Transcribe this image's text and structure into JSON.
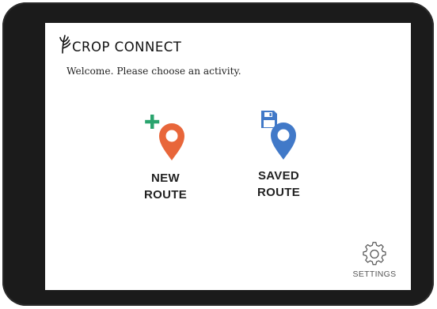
{
  "app": {
    "brand": "CROP CONNECT",
    "welcome_text": "Welcome. Please choose an activity."
  },
  "activities": [
    {
      "label_line1": "NEW",
      "label_line2": "ROUTE",
      "icon": "add-map-pin-icon",
      "accent": "#e8663a",
      "badge_color": "#2aa46e"
    },
    {
      "label_line1": "SAVED",
      "label_line2": "ROUTE",
      "icon": "save-map-pin-icon",
      "accent": "#4179c8"
    }
  ],
  "settings": {
    "label": "SETTINGS",
    "icon": "gear-icon"
  },
  "colors": {
    "device_frame": "#1b1b1b",
    "screen": "#ffffff"
  }
}
